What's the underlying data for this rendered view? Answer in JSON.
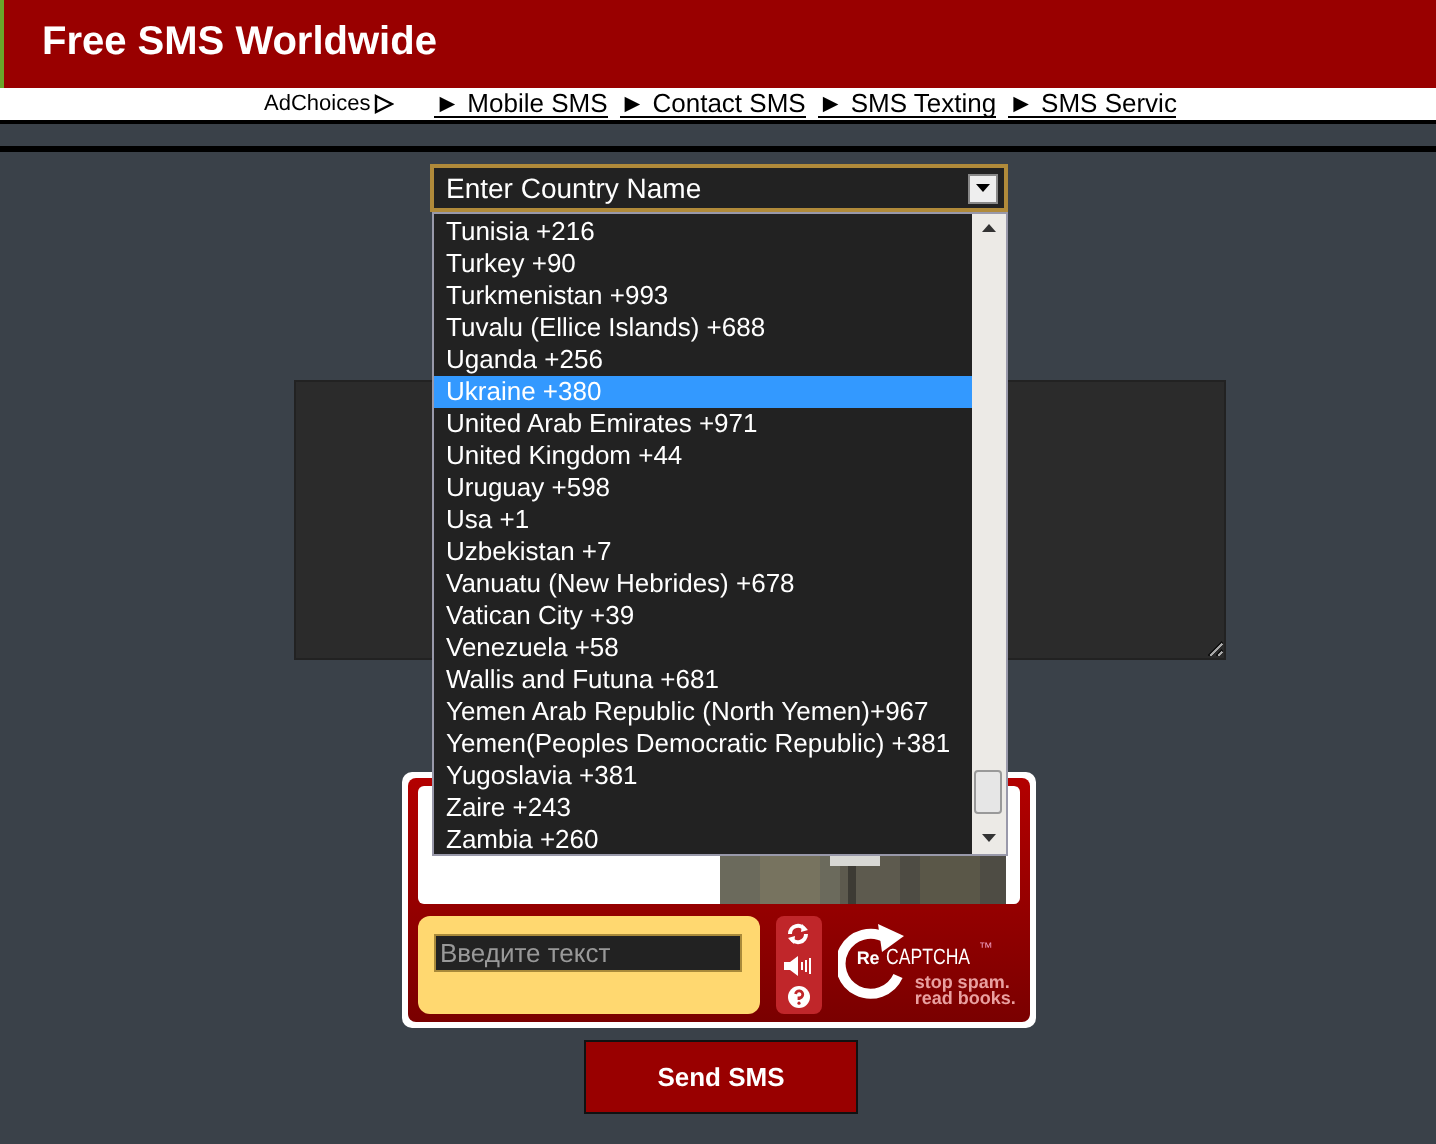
{
  "header": {
    "title": "Free SMS Worldwide"
  },
  "nav": {
    "ad_label": "AdChoices",
    "links": [
      {
        "arrow": "►",
        "label": "Mobile SMS"
      },
      {
        "arrow": "►",
        "label": "Contact SMS"
      },
      {
        "arrow": "►",
        "label": "SMS Texting"
      },
      {
        "arrow": "►",
        "label": "SMS Servic"
      }
    ]
  },
  "country_select": {
    "placeholder": "Enter Country Name",
    "expanded": true,
    "options": [
      {
        "label": "Tunisia +216",
        "selected": false
      },
      {
        "label": "Turkey +90",
        "selected": false
      },
      {
        "label": "Turkmenistan +993",
        "selected": false
      },
      {
        "label": "Tuvalu (Ellice Islands) +688",
        "selected": false
      },
      {
        "label": "Uganda +256",
        "selected": false
      },
      {
        "label": "Ukraine +380",
        "selected": true
      },
      {
        "label": "United Arab Emirates +971",
        "selected": false
      },
      {
        "label": "United Kingdom +44",
        "selected": false
      },
      {
        "label": "Uruguay +598",
        "selected": false
      },
      {
        "label": "Usa +1",
        "selected": false
      },
      {
        "label": "Uzbekistan +7",
        "selected": false
      },
      {
        "label": "Vanuatu (New Hebrides) +678",
        "selected": false
      },
      {
        "label": "Vatican City +39",
        "selected": false
      },
      {
        "label": "Venezuela +58",
        "selected": false
      },
      {
        "label": "Wallis and Futuna +681",
        "selected": false
      },
      {
        "label": "Yemen Arab Republic (North Yemen)+967",
        "selected": false
      },
      {
        "label": "Yemen(Peoples Democratic Republic) +381",
        "selected": false
      },
      {
        "label": "Yugoslavia +381",
        "selected": false
      },
      {
        "label": "Zaire +243",
        "selected": false
      },
      {
        "label": "Zambia +260",
        "selected": false
      }
    ]
  },
  "captcha": {
    "placeholder": "Введите текст",
    "logo": {
      "re": "Re",
      "name": "CAPTCHA",
      "tm": "™",
      "line_1": "stop spam.",
      "line_2": "read books."
    }
  },
  "send_button": {
    "label": "Send SMS"
  }
}
